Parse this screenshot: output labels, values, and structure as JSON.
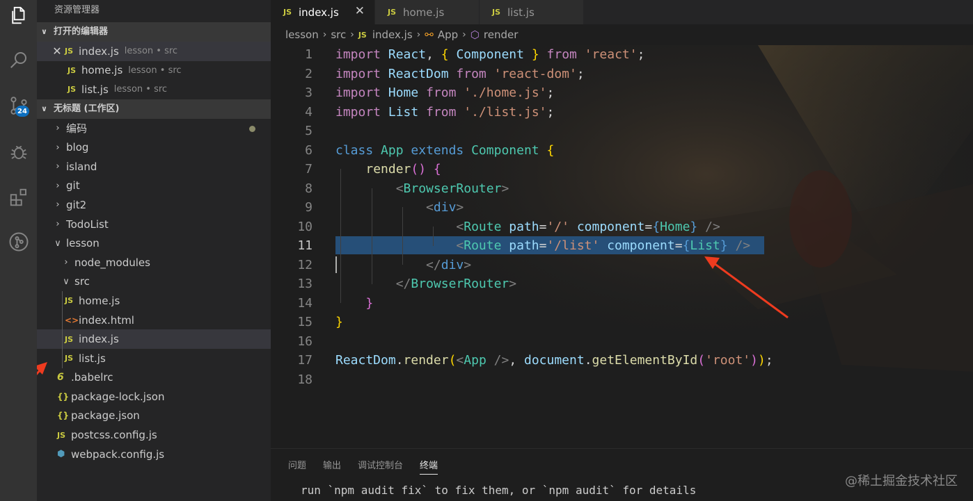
{
  "activity_bar": {
    "icons": [
      "explorer-icon",
      "search-icon",
      "source-control-icon",
      "debug-icon",
      "extensions-icon",
      "git-graph-icon"
    ],
    "scm_badge": "24"
  },
  "sidebar": {
    "title": "资源管理器",
    "open_editors": {
      "header": "打开的编辑器",
      "items": [
        {
          "name": "index.js",
          "desc": "lesson • src"
        },
        {
          "name": "home.js",
          "desc": "lesson • src"
        },
        {
          "name": "list.js",
          "desc": "lesson • src"
        }
      ]
    },
    "workspace": {
      "header": "无标题 (工作区)",
      "items": [
        {
          "name": "编码"
        },
        {
          "name": "blog"
        },
        {
          "name": "island"
        },
        {
          "name": "git"
        },
        {
          "name": "git2"
        },
        {
          "name": "TodoList"
        },
        {
          "name": "lesson"
        },
        {
          "name": "node_modules"
        },
        {
          "name": "src"
        },
        {
          "name": "home.js"
        },
        {
          "name": "index.html"
        },
        {
          "name": "index.js"
        },
        {
          "name": "list.js"
        },
        {
          "name": ".babelrc"
        },
        {
          "name": "package-lock.json"
        },
        {
          "name": "package.json"
        },
        {
          "name": "postcss.config.js"
        },
        {
          "name": "webpack.config.js"
        }
      ]
    }
  },
  "tabs": [
    {
      "label": "index.js",
      "active": true
    },
    {
      "label": "home.js",
      "active": false
    },
    {
      "label": "list.js",
      "active": false
    }
  ],
  "breadcrumb": [
    "lesson",
    "src",
    "index.js",
    "App",
    "render"
  ],
  "editor": {
    "line_numbers": [
      "1",
      "2",
      "3",
      "4",
      "5",
      "6",
      "7",
      "8",
      "9",
      "10",
      "11",
      "12",
      "13",
      "14",
      "15",
      "16",
      "17",
      "18"
    ],
    "selected_line": "11"
  },
  "panel": {
    "tabs": [
      "问题",
      "输出",
      "调试控制台",
      "终端"
    ],
    "active_tab": "终端",
    "terminal_line": "run `npm audit fix` to fix them, or `npm audit` for details"
  },
  "watermark": "@稀土掘金技术社区",
  "file_icon_text": "JS",
  "colors": {
    "selection": "#264f78",
    "keyword": "#569cd6",
    "import_keyword": "#c586c0",
    "string": "#ce9178",
    "class": "#4ec9b0",
    "arrow": "#ee3b1f"
  }
}
